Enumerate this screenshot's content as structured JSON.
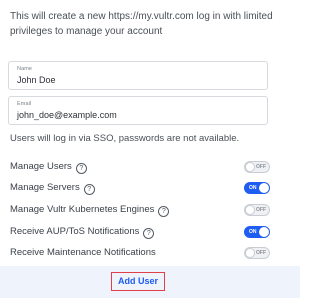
{
  "intro_text": "This will create a new https://my.vultr.com log in with limited privileges to manage your account",
  "name_field": {
    "label": "Name",
    "value": "John Doe"
  },
  "email_field": {
    "label": "Email",
    "value": "john_doe@example.com"
  },
  "sso_note": "Users will log in via SSO, passwords are not available.",
  "permissions": [
    {
      "label": "Manage Users",
      "help_icon": "question-circle",
      "state": "OFF",
      "on": false
    },
    {
      "label": "Manage Servers",
      "help_icon": "question-circle",
      "state": "ON",
      "on": true
    },
    {
      "label": "Manage Vultr Kubernetes Engines",
      "help_icon": "question-circle",
      "state": "OFF",
      "on": false
    },
    {
      "label": "Receive AUP/ToS Notifications",
      "help_icon": "question-circle",
      "state": "ON",
      "on": true
    },
    {
      "label": "Receive Maintenance Notifications",
      "state": "OFF",
      "on": false
    }
  ],
  "add_user_label": "Add User",
  "colors": {
    "accent": "#1e5cf2",
    "footer_bg": "#eef3fc",
    "button_border": "#e0404a"
  }
}
